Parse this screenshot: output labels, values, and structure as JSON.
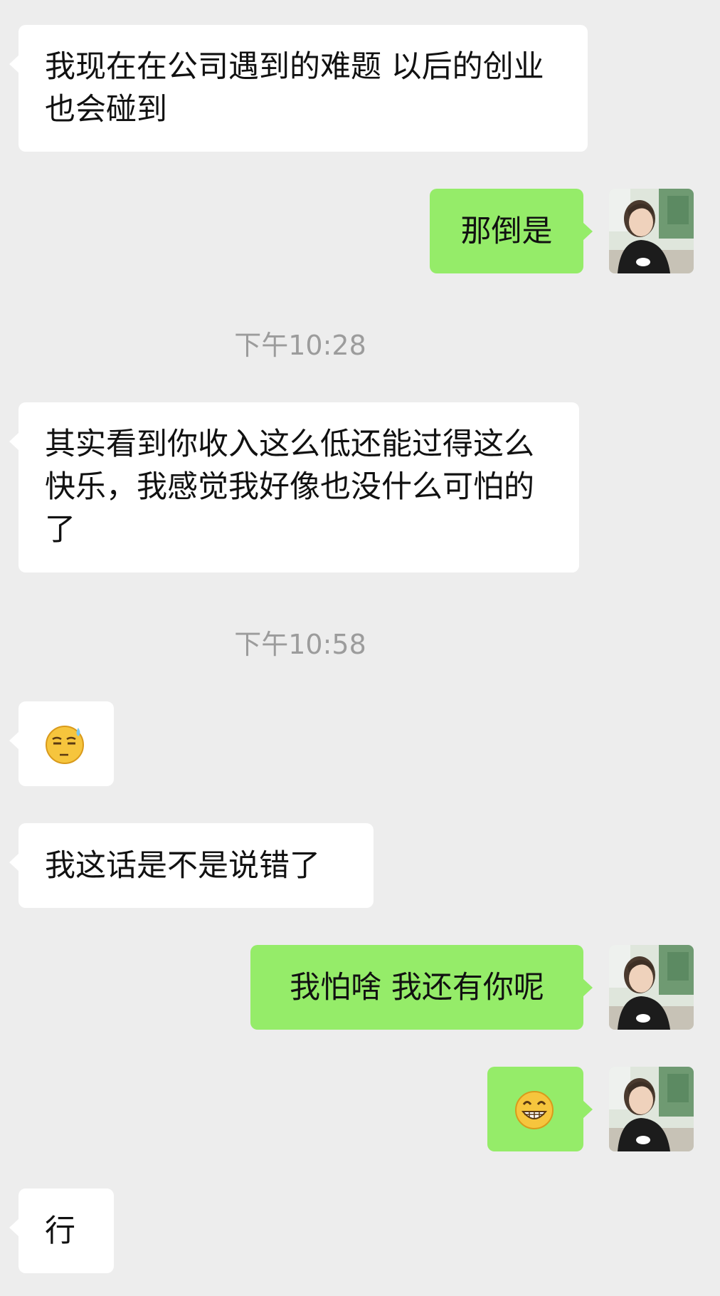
{
  "chat": {
    "messages": [
      {
        "side": "incoming",
        "kind": "text",
        "text": "我现在在公司遇到的难题 以后的创业也会碰到"
      },
      {
        "side": "outgoing",
        "kind": "text",
        "text": "那倒是"
      },
      {
        "kind": "timestamp",
        "text": "下午10:28"
      },
      {
        "side": "incoming",
        "kind": "text",
        "text": "其实看到你收入这么低还能过得这么快乐，我感觉我好像也没什么可怕的了"
      },
      {
        "kind": "timestamp",
        "text": "下午10:58"
      },
      {
        "side": "incoming",
        "kind": "emoji",
        "emoji": "awkward-sweat-emoji"
      },
      {
        "side": "incoming",
        "kind": "text",
        "text": "我这话是不是说错了"
      },
      {
        "side": "outgoing",
        "kind": "text",
        "text": "我怕啥 我还有你呢"
      },
      {
        "side": "outgoing",
        "kind": "emoji",
        "emoji": "grin-emoji"
      },
      {
        "side": "incoming",
        "kind": "text",
        "text": "行"
      }
    ]
  },
  "colors": {
    "background": "#ededed",
    "incoming_bubble": "#ffffff",
    "outgoing_bubble": "#95ec69",
    "timestamp_text": "#9c9c9c",
    "message_text": "#111111"
  }
}
